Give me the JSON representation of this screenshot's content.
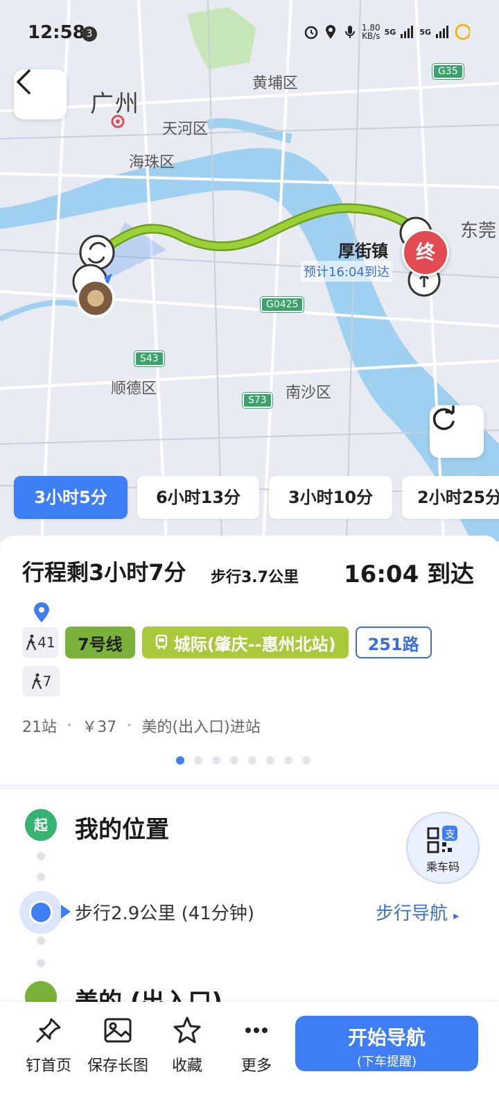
{
  "status_bar": {
    "time": "12:58",
    "badge": "3",
    "net_speed": "1.80\nKB/s",
    "signal1": "5G",
    "signal2": "5G"
  },
  "map": {
    "labels": {
      "guangzhou": "广州",
      "tianhe": "天河区",
      "haizhu": "海珠区",
      "huangpu": "黄埔区",
      "shunde": "顺德区",
      "nansha": "南沙区",
      "dongguan": "东莞"
    },
    "highways": {
      "g35": "G35",
      "g0425": "G0425",
      "s43": "S43",
      "s73": "S73"
    },
    "destination": {
      "name": "厚街镇",
      "eta": "预计16:04到达",
      "marker": "终"
    }
  },
  "route_tabs": [
    {
      "label": "3小时5分",
      "active": true
    },
    {
      "label": "6小时13分",
      "active": false
    },
    {
      "label": "3小时10分",
      "active": false
    },
    {
      "label": "2小时25分",
      "active": false
    }
  ],
  "summary": {
    "remaining": "行程剩3小时7分",
    "walk": "步行3.7公里",
    "arrive": "16:04 到达",
    "walk_minutes_1": "41",
    "line_metro": "7号线",
    "line_intercity": "城际(肇庆--惠州北站)",
    "line_bus": "251路",
    "walk_minutes_2": "7",
    "stations": "21站",
    "price": "￥37",
    "entrance": "美的(出入口)进站",
    "page_count": 8,
    "page_active": 0
  },
  "steps": {
    "start_badge": "起",
    "start_name": "我的位置",
    "walk_desc": "步行2.9公里 (41分钟)",
    "walk_nav": "步行导航",
    "qr_label": "乘车码",
    "next_stop": "美的 (出入口)"
  },
  "bottom_bar": {
    "pin": "钉首页",
    "save": "保存长图",
    "fav": "收藏",
    "more": "更多",
    "start_nav": "开始导航",
    "start_nav_sub": "(下车提醒)"
  },
  "colors": {
    "accent": "#3d7ef5",
    "route": "#8bbf2a",
    "end": "#e14b52",
    "start": "#37b371"
  }
}
